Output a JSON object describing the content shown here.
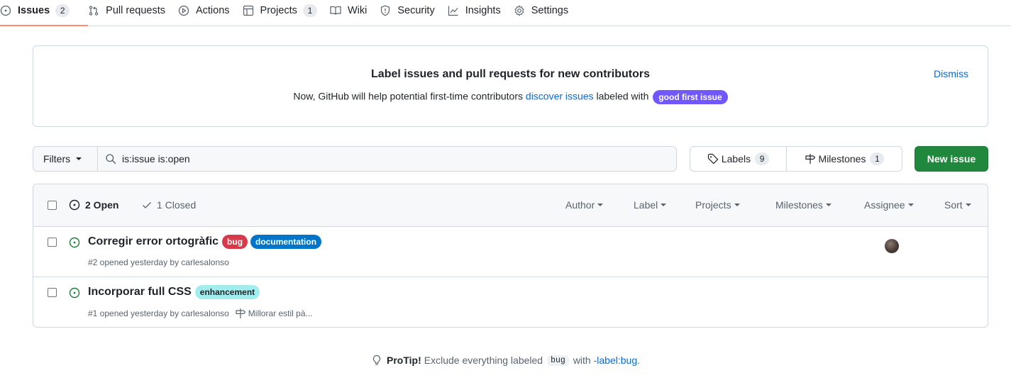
{
  "nav": {
    "tabs": [
      {
        "label": "Issues",
        "count": "2",
        "icon": "issue-opened-icon"
      },
      {
        "label": "Pull requests",
        "icon": "git-pull-request-icon"
      },
      {
        "label": "Actions",
        "icon": "play-icon"
      },
      {
        "label": "Projects",
        "count": "1",
        "icon": "table-icon"
      },
      {
        "label": "Wiki",
        "icon": "book-icon"
      },
      {
        "label": "Security",
        "icon": "shield-icon"
      },
      {
        "label": "Insights",
        "icon": "graph-icon"
      },
      {
        "label": "Settings",
        "icon": "gear-icon"
      }
    ],
    "active_tab": "Issues",
    "active_color": "#fd8c73"
  },
  "banner": {
    "title": "Label issues and pull requests for new contributors",
    "text_before": "Now, GitHub will help potential first-time contributors ",
    "link_text": "discover issues",
    "text_after": " labeled with ",
    "label": "good first issue",
    "label_color": "#7057ff",
    "dismiss": "Dismiss"
  },
  "toolbar": {
    "filters_label": "Filters",
    "search_value": "is:issue is:open",
    "labels_label": "Labels",
    "labels_count": "9",
    "milestones_label": "Milestones",
    "milestones_count": "1",
    "new_issue_label": "New issue",
    "new_issue_color": "#1f883d"
  },
  "list_header": {
    "open": "2 Open",
    "closed": "1 Closed",
    "filters": [
      "Author",
      "Label",
      "Projects",
      "Milestones",
      "Assignee",
      "Sort"
    ]
  },
  "issues": [
    {
      "title": "Corregir error ortogràfic",
      "labels": [
        {
          "name": "bug",
          "bg": "#d73a4a",
          "fg": "#ffffff"
        },
        {
          "name": "documentation",
          "bg": "#0075ca",
          "fg": "#ffffff"
        }
      ],
      "meta": "#2 opened yesterday by carlesalonso",
      "milestone": "",
      "has_assignee": true
    },
    {
      "title": "Incorporar full CSS",
      "labels": [
        {
          "name": "enhancement",
          "bg": "#a2eeef",
          "fg": "#1f2328"
        }
      ],
      "meta": "#1 opened yesterday by carlesalonso",
      "milestone": "Millorar estil pà...",
      "has_assignee": false
    }
  ],
  "protip": {
    "title": "ProTip!",
    "text_before": "Exclude everything labeled",
    "code": "bug",
    "text_mid": "with",
    "link": "-label:bug",
    "text_after": "."
  }
}
